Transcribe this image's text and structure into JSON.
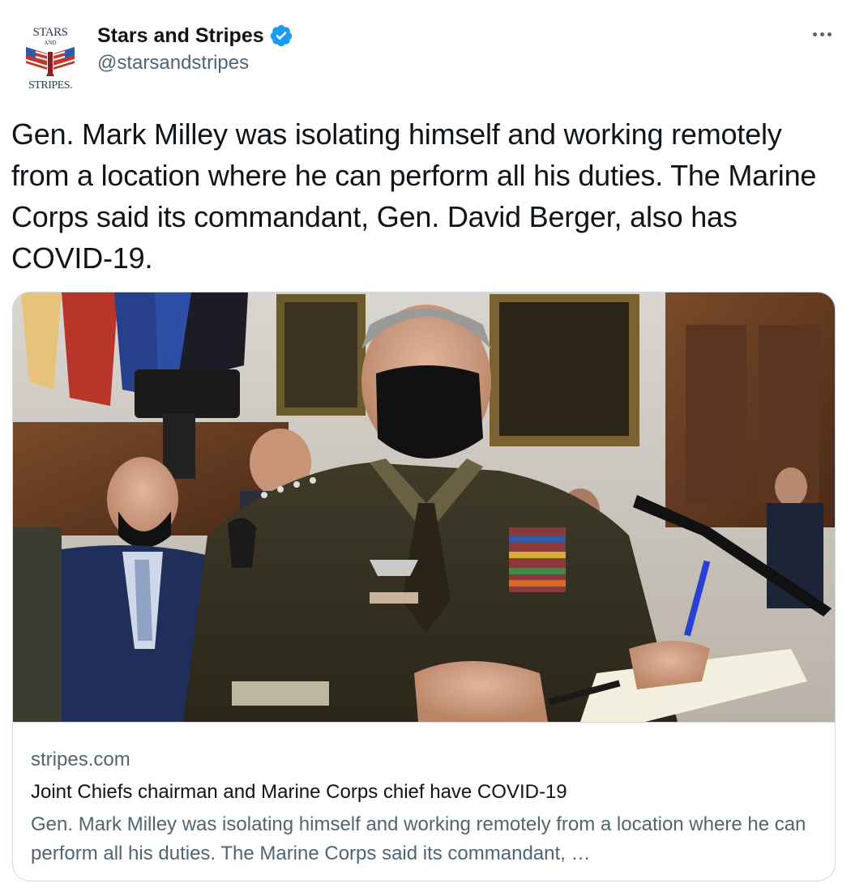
{
  "author": {
    "display_name": "Stars and Stripes",
    "handle": "@starsandstripes",
    "avatar_text_top": "STARS",
    "avatar_text_middle": "AND",
    "avatar_text_bottom": "STRIPES.",
    "verified": true,
    "verified_color": "#1d9bf0"
  },
  "tweet": {
    "text": "Gen. Mark Milley was isolating himself and working remotely from a location where he can perform all his duties. The Marine Corps said its commandant, Gen. David Berger, also has COVID-19."
  },
  "card": {
    "domain": "stripes.com",
    "title": "Joint Chiefs chairman and Marine Corps chief have COVID-19",
    "description": "Gen. Mark Milley was isolating himself and working remotely from a location where he can perform all his duties. The Marine Corps said its commandant, …"
  },
  "icons": {
    "more": "more-options-icon",
    "verified": "verified-badge-icon"
  }
}
